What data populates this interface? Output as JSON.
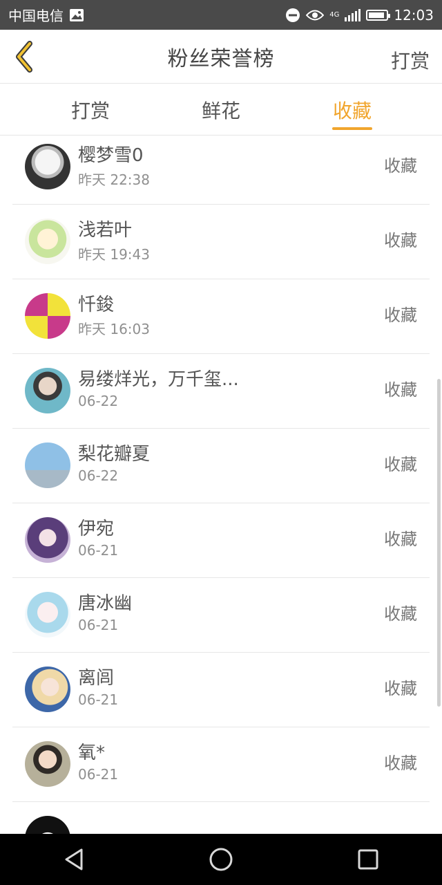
{
  "status_bar": {
    "carrier": "中国电信",
    "time": "12:03",
    "network": "4G"
  },
  "header": {
    "title": "粉丝荣誉榜",
    "right_label": "打赏"
  },
  "tabs": [
    {
      "label": "打赏",
      "active": false
    },
    {
      "label": "鲜花",
      "active": false
    },
    {
      "label": "收藏",
      "active": true
    }
  ],
  "accent_color": "#f1a52d",
  "rows": [
    {
      "name": "樱梦雪0",
      "date": "昨天 22:38",
      "action": "收藏",
      "avatar": "bw-girl-avatar"
    },
    {
      "name": "浅若叶",
      "date": "昨天 19:43",
      "action": "收藏",
      "avatar": "anime-chibi-avatar"
    },
    {
      "name": "忏鋑",
      "date": "昨天 16:03",
      "action": "收藏",
      "avatar": "pattern-avatar"
    },
    {
      "name": "易缕烊光，万千玺...",
      "date": "06-22",
      "action": "收藏",
      "avatar": "photo-avatar"
    },
    {
      "name": "梨花瓣夏",
      "date": "06-22",
      "action": "收藏",
      "avatar": "girl-sky-avatar"
    },
    {
      "name": "伊宛",
      "date": "06-21",
      "action": "收藏",
      "avatar": "anime-purple-avatar"
    },
    {
      "name": "唐冰幽",
      "date": "06-21",
      "action": "收藏",
      "avatar": "anime-blue-avatar"
    },
    {
      "name": "离闾",
      "date": "06-21",
      "action": "收藏",
      "avatar": "anime-blonde-avatar"
    },
    {
      "name": "氧*",
      "date": "06-21",
      "action": "收藏",
      "avatar": "painting-avatar"
    },
    {
      "name": "",
      "date": "",
      "action": "",
      "avatar": "partial-avatar"
    }
  ]
}
